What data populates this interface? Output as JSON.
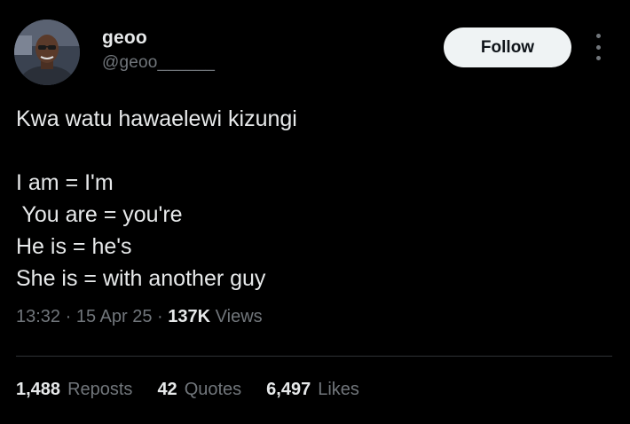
{
  "author": {
    "display_name": "geoo",
    "handle": "@geoo______"
  },
  "follow_label": "Follow",
  "more_icon": "more-vertical-icon",
  "tweet": {
    "lines": [
      "Kwa watu hawaelewi kizungi",
      "",
      "I am = I'm",
      " You are = you're",
      "He is = he's",
      "She is = with another guy"
    ]
  },
  "meta": {
    "time": "13:32",
    "date": "15 Apr 25",
    "views_count": "137K",
    "views_label": "Views",
    "separator": "·"
  },
  "stats": {
    "reposts_count": "1,488",
    "reposts_label": "Reposts",
    "quotes_count": "42",
    "quotes_label": "Quotes",
    "likes_count": "6,497",
    "likes_label": "Likes"
  },
  "colors": {
    "background": "#000000",
    "primary_text": "#e7e9ea",
    "secondary_text": "#71767b",
    "button_bg": "#eff3f4",
    "divider": "#2f3336"
  }
}
